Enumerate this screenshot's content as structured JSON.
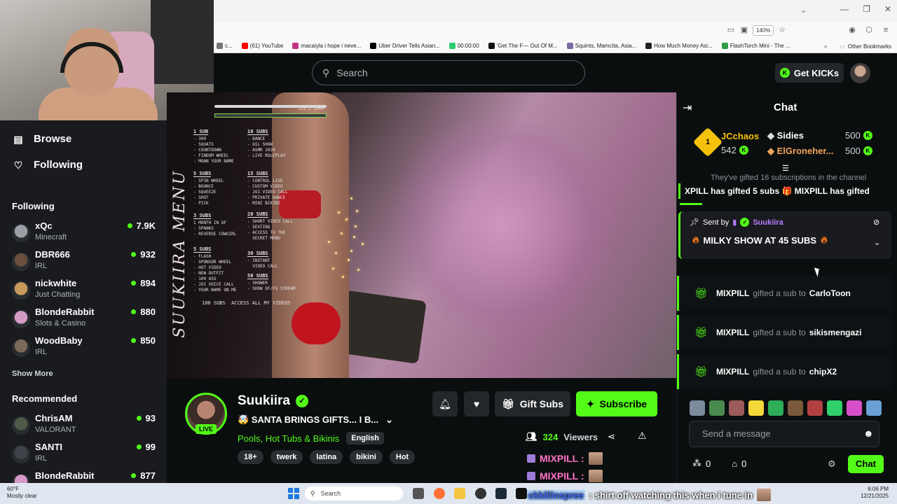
{
  "browser": {
    "zoom": "140%",
    "bookmarks": [
      {
        "label": "c...",
        "color": "#777777"
      },
      {
        "label": "(61) YouTube",
        "color": "#ff0000"
      },
      {
        "label": "macaiyla i hope i neve...",
        "color": "#c13584"
      },
      {
        "label": "Uber Driver Tells Asian...",
        "color": "#000000"
      },
      {
        "label": "00:00:00",
        "color": "#2ecc71"
      },
      {
        "label": "'Get The F— Out Of M...",
        "color": "#111111"
      },
      {
        "label": "Squints, Mamcita, Asia...",
        "color": "#7a6aa0"
      },
      {
        "label": "How Much Money Asi...",
        "color": "#222222"
      },
      {
        "label": "FlashTorch Mini - The ...",
        "color": "#2f9e44"
      }
    ],
    "other_bookmarks": "Other Bookmarks"
  },
  "header": {
    "search_placeholder": "Search",
    "get_kicks": "Get KICKs"
  },
  "sidebar": {
    "nav": [
      {
        "label": "Browse",
        "icon": "browse-icon"
      },
      {
        "label": "Following",
        "icon": "heart-icon"
      }
    ],
    "following_title": "Following",
    "following": [
      {
        "name": "xQc",
        "category": "Minecraft",
        "viewers": "7.9K",
        "color": "#9aa0a6"
      },
      {
        "name": "DBR666",
        "category": "IRL",
        "viewers": "932",
        "color": "#6b4e3d"
      },
      {
        "name": "nickwhite",
        "category": "Just Chatting",
        "viewers": "894",
        "color": "#c69a5d"
      },
      {
        "name": "BlondeRabbit",
        "category": "Slots & Casino",
        "viewers": "880",
        "color": "#d59ac6"
      },
      {
        "name": "WoodBaby",
        "category": "IRL",
        "viewers": "850",
        "color": "#7a6a5a"
      }
    ],
    "show_more": "Show More",
    "recommended_title": "Recommended",
    "recommended": [
      {
        "name": "ChrisAM",
        "category": "VALORANT",
        "viewers": "93",
        "color": "#4f5a4b"
      },
      {
        "name": "SANTI",
        "category": "IRL",
        "viewers": "99",
        "color": "#40444a"
      },
      {
        "name": "BlondeRabbit",
        "category": "",
        "viewers": "877",
        "color": "#d59ac6"
      }
    ]
  },
  "video": {
    "menu_word": "SUUKIIRA MENU",
    "progress_text": "222 / 1000",
    "tiers_left": [
      {
        "head": "1 SUB",
        "items": "- 300\n- SQUATS\n- COUNTDOWN\n- FINDOM WHEEL\n- MOAN YOUR NAME"
      },
      {
        "head": "5 SUBS",
        "items": "- SPIN WHEEL\n- BOUNCE\n- SQUEEZE\n- SHOT\n- PICK"
      },
      {
        "head": "3 SUBS",
        "items": "1 MONTH IN OF\n- SPANKS\n- REVERSE COWGIRL"
      },
      {
        "head": "5 SUBS",
        "items": "- FLASH\n- SPONSOR WHEEL\n- HOT VIDEO\n- NEW OUTFIT\n- 100 ASS\n- JOI VOICE CALL\n- YOUR NAME ON ME"
      }
    ],
    "tiers_right": [
      {
        "head": "10 SUBS",
        "items": "- DANCE\n- OIL SHOW\n- ASMR 2020\n- LIVE ROLEPLAY"
      },
      {
        "head": "15 SUBS",
        "items": "- CONTROL LIVE\n- CUSTOM VIDEO\n- JOI VIDEO CALL\n- PRIVATE DANCE\n- MINI BIKINI"
      },
      {
        "head": "20 SUBS",
        "items": "- SHORT VIDEO CALL\n- SEXTING\n- ACCESS TO THE\n  SECRET MENU"
      },
      {
        "head": "30 SUBS",
        "items": "- INSTANT\n  VIDEO CALL"
      },
      {
        "head": "50 SUBS",
        "items": "- SHOWER\n- SHOW OF/FS STREAM"
      }
    ],
    "footer_line": "100 SUBS  ACCESS ALL MY VIDEOS"
  },
  "stream": {
    "name": "Suukiira",
    "live": "LIVE",
    "title": "🤯 SANTA BRINGS GIFTS... I B...",
    "category": "Pools, Hot Tubs & Bikinis",
    "language": "English",
    "tags": [
      "18+",
      "twerk",
      "latina",
      "bikini",
      "Hot"
    ],
    "gift_subs": "Gift Subs",
    "subscribe": "Subscribe",
    "viewers": "324",
    "viewers_label": "Viewers"
  },
  "below_chat": [
    {
      "user": "MIXPILL :"
    },
    {
      "user": "MIXPILL :"
    }
  ],
  "chat": {
    "title": "Chat",
    "leaderboard": [
      {
        "name": "JCchaos",
        "amount": "542",
        "color": "#f5c20b"
      },
      {
        "name": "Sidies",
        "amount": "500",
        "color": "#ffffff"
      },
      {
        "name": "ElGroneher...",
        "amount": "500",
        "color": "#f0a35b"
      }
    ],
    "gifted_note": "They've gifted 16 subscriptions in the channel",
    "ticker": "XPILL has gifted 5 subs  🎁  MIXPILL has gifted",
    "ticker_user": "MI",
    "pinned": {
      "sent_by": "Sent by",
      "user": "Suukiira",
      "message": "MILKY SHOW AT 45 SUBS"
    },
    "gifts": [
      {
        "from": "MIXPILL",
        "mid": "gifted a sub to",
        "to": "CarloToon"
      },
      {
        "from": "MIXPILL",
        "mid": "gifted a sub to",
        "to": "sikismengazi"
      },
      {
        "from": "MIXPILL",
        "mid": "gifted a sub to",
        "to": "chipX2"
      }
    ],
    "emote_colors": [
      "#7b8a9c",
      "#4a8a4f",
      "#9c5a5a",
      "#f5d93a",
      "#2fae59",
      "#7a5a3a",
      "#b34141",
      "#2fcf6a",
      "#d64fc9",
      "#6aa0d6"
    ],
    "input_placeholder": "Send a message",
    "points": "0",
    "store": "0",
    "send": "Chat"
  },
  "taskbar": {
    "temp": "60°F",
    "weather": "Mostly clear",
    "search": "Search",
    "time": "6:06 PM",
    "date": "12/21/2025",
    "overlay_user": "ckkillinspree",
    "overlay_msg": ": shirt off watching this when i tune in"
  }
}
